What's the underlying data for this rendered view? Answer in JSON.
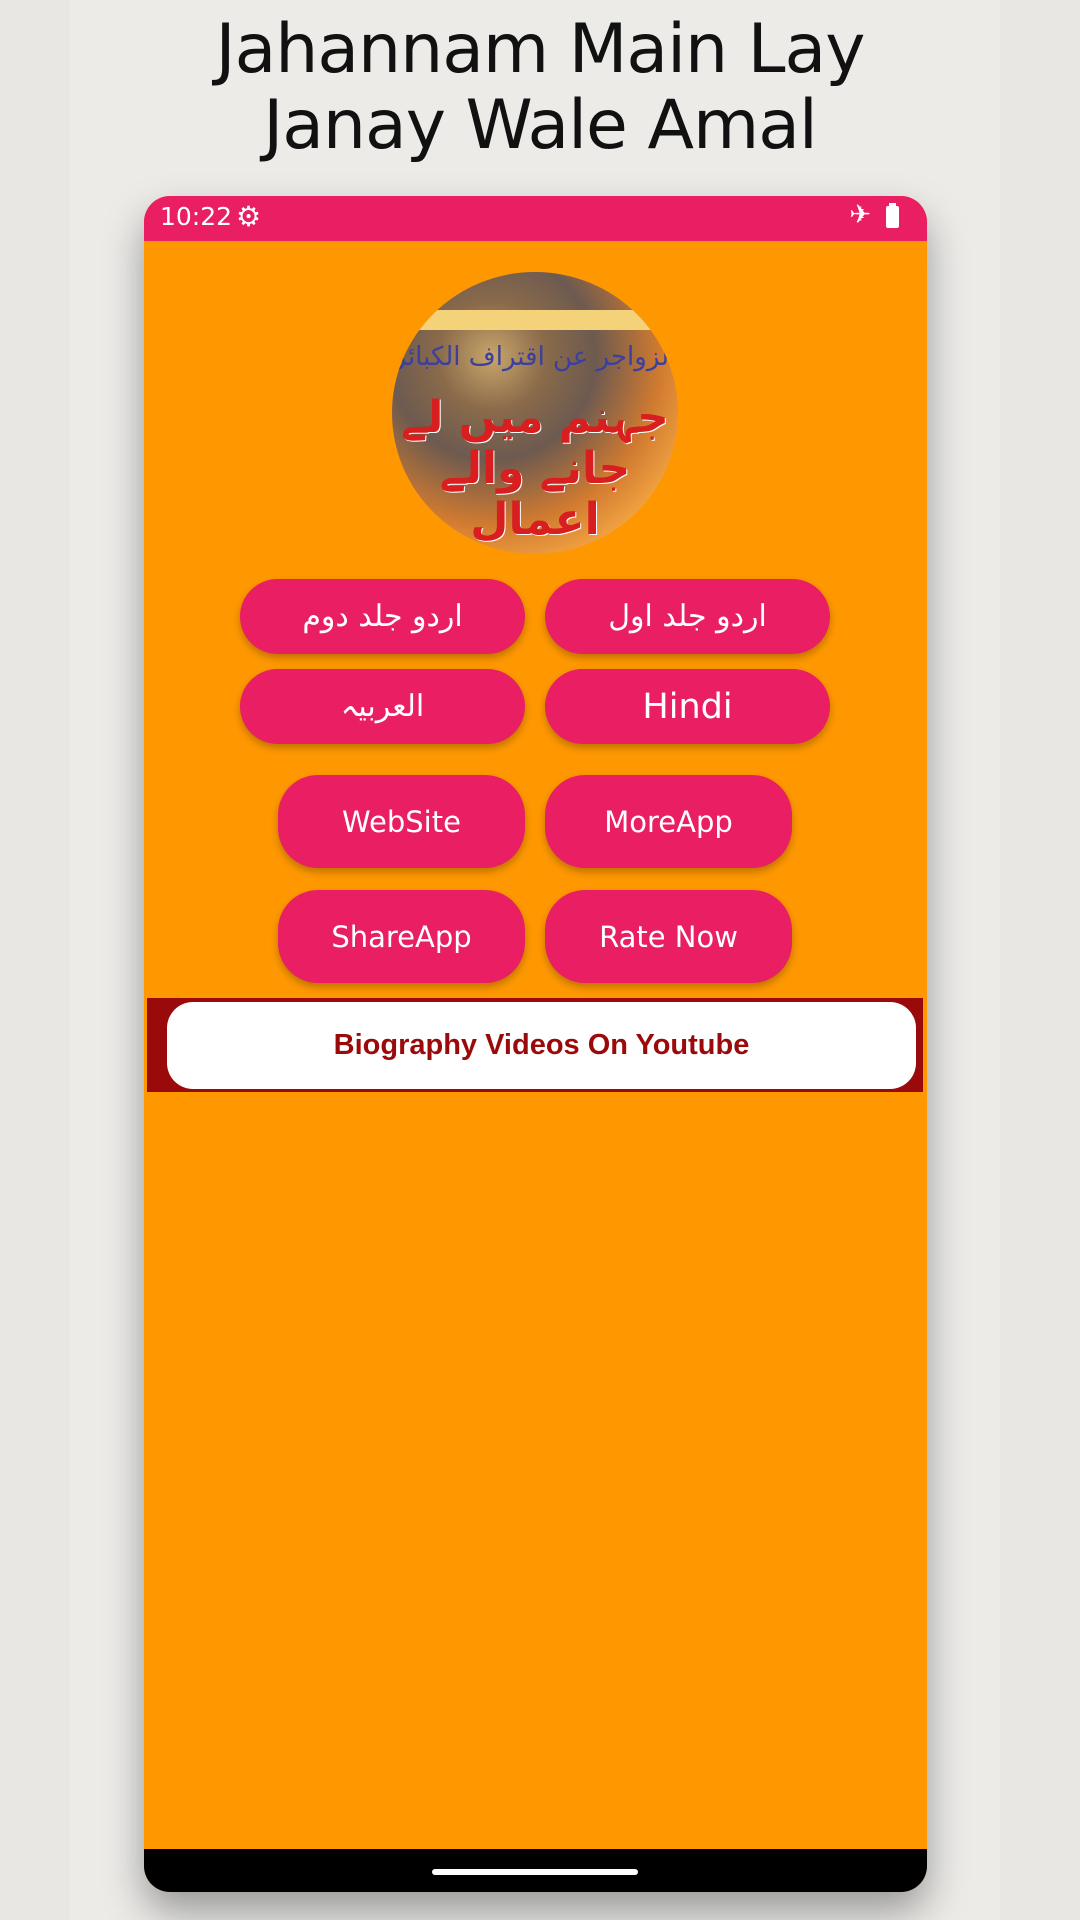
{
  "promo": {
    "title_line1": "Jahannam Main Lay",
    "title_line2": "Janay Wale Amal"
  },
  "status_bar": {
    "time": "10:22",
    "icons": [
      "settings-gear-icon",
      "airplane-mode-icon",
      "battery-icon"
    ],
    "color": "#e91e63"
  },
  "cover": {
    "subtitle": "الزواجر عن اقتراف الکبائر",
    "title": "جہنم میں لے جانے والے اعمال"
  },
  "buttons": {
    "urdu_vol1": "اردو جلد اول",
    "urdu_vol2": "اردو جلد دوم",
    "hindi": "Hindi",
    "arabic": "العربیہ",
    "website": "WebSite",
    "more_app": "MoreApp",
    "share_app": "ShareApp",
    "rate_now": "Rate Now"
  },
  "banner": {
    "label": "Biography Videos On Youtube"
  },
  "colors": {
    "background": "#ff9800",
    "button": "#e91e63",
    "banner_border": "#9b0a0a"
  }
}
